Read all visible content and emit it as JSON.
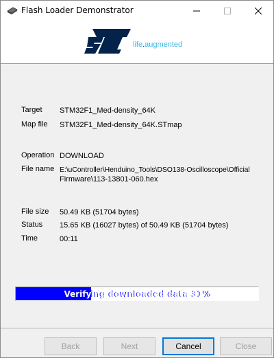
{
  "window": {
    "title": "Flash Loader Demonstrator"
  },
  "banner": {
    "tagline_pre": "life",
    "tagline_dot": ".",
    "tagline_post": "augmented"
  },
  "info": {
    "target_label": "Target",
    "target_value": "STM32F1_Med-density_64K",
    "mapfile_label": "Map file",
    "mapfile_value": "STM32F1_Med-density_64K.STmap",
    "operation_label": "Operation",
    "operation_value": "DOWNLOAD",
    "filename_label": "File name",
    "filename_value_line1": "E:\\uController\\Henduino_Tools\\DSO138-Oscilloscope\\Official",
    "filename_value_line2": "Firmware\\113-13801-060.hex",
    "filesize_label": "File size",
    "filesize_value": "50.49 KB (51704 bytes)",
    "status_label": "Status",
    "status_value": "15.65 KB (16027 bytes) of 50.49 KB (51704 bytes)",
    "time_label": "Time",
    "time_value": "00:11"
  },
  "progress": {
    "text": "Verifying downloaded data 31%",
    "percent": 31,
    "fill_color": "#0000ff"
  },
  "buttons": {
    "back": "Back",
    "next": "Next",
    "cancel": "Cancel",
    "close": "Close"
  }
}
